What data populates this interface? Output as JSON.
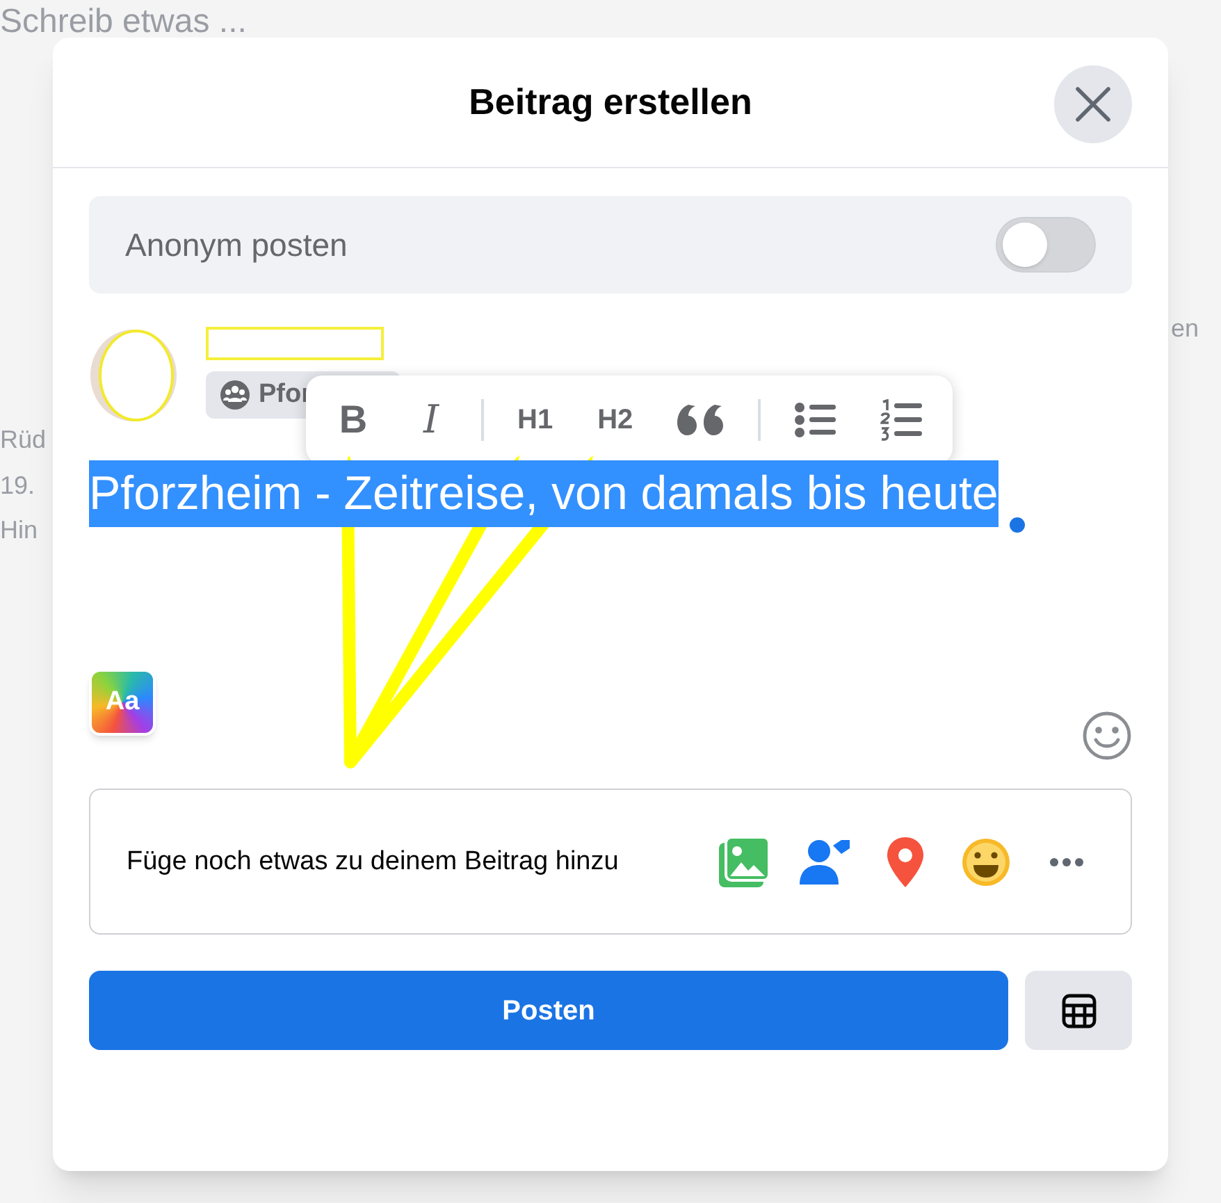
{
  "background": {
    "texts": [
      "Schreib etwas ...",
      "Rüd",
      "19.",
      "Hin",
      "en"
    ]
  },
  "dialog": {
    "title": "Beitrag erstellen"
  },
  "anonymous": {
    "label": "Anonym posten",
    "on": false
  },
  "author": {
    "audience": "Pfor"
  },
  "toolbar": {
    "buttons": [
      {
        "kind": "bold",
        "label": "B"
      },
      {
        "kind": "italic",
        "label": "I"
      },
      {
        "kind": "divider"
      },
      {
        "kind": "heading",
        "label": "H1"
      },
      {
        "kind": "heading",
        "label": "H2"
      },
      {
        "kind": "quote"
      },
      {
        "kind": "divider"
      },
      {
        "kind": "bullets"
      },
      {
        "kind": "numbers"
      }
    ]
  },
  "editor": {
    "text": "Pforzheim - Zeitreise, von damals bis heute",
    "selected": true,
    "style_button": "Aa"
  },
  "add_bar": {
    "label": "Füge noch etwas zu deinem Beitrag hinzu"
  },
  "post_button": {
    "label": "Posten"
  }
}
